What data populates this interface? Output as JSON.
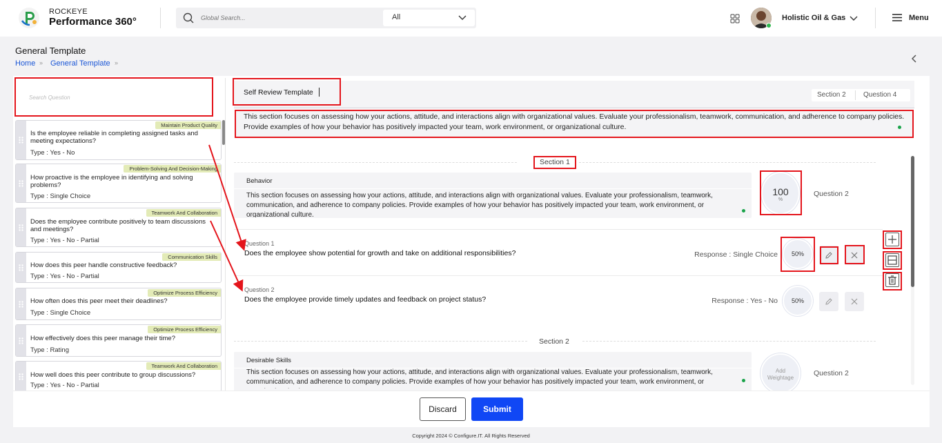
{
  "header": {
    "brand_small": "ROCKEYE",
    "brand_big": "Performance 360°",
    "search_placeholder": "Global Search...",
    "search_scope": "All",
    "org_name": "Holistic Oil & Gas",
    "menu_label": "Menu"
  },
  "page": {
    "title": "General Template",
    "breadcrumb": [
      "Home",
      "General Template"
    ]
  },
  "left_panel": {
    "search_placeholder": "Search Question",
    "questions": [
      {
        "tag": "Maintain Product Quality",
        "text": "Is the employee reliable in completing assigned tasks and meeting expectations?",
        "type": "Type : Yes - No"
      },
      {
        "tag": "Problem-Solving And Decision-Making",
        "text": "How proactive is the employee in identifying and solving problems?",
        "type": "Type : Single Choice"
      },
      {
        "tag": "Teamwork And Collaboration",
        "text": "Does the employee contribute positively to team discussions and meetings?",
        "type": "Type : Yes - No - Partial"
      },
      {
        "tag": "Communication Skills",
        "text": "How does this peer handle constructive feedback?",
        "type": "Type : Yes - No - Partial"
      },
      {
        "tag": "Optimize Process Efficiency",
        "text": "How often does this peer meet their deadlines?",
        "type": "Type : Single Choice"
      },
      {
        "tag": "Optimize Process Efficiency",
        "text": "How effectively does this peer manage their time?",
        "type": "Type : Rating"
      },
      {
        "tag": "Teamwork And Collaboration",
        "text": "How well does this peer contribute to group discussions?",
        "type": "Type : Yes - No - Partial"
      }
    ]
  },
  "template": {
    "title": "Self Review Template",
    "section_count": "Section 2",
    "question_count": "Question 4",
    "description": "This section focuses on assessing how your actions, attitude, and interactions align with organizational values. Evaluate your professionalism, teamwork, communication, and adherence to company policies. Provide examples of how your behavior has positively impacted your team, work environment, or organizational culture."
  },
  "sections": [
    {
      "label": "Section 1",
      "name": "Behavior",
      "description": "This section focuses on assessing how your actions, attitude, and interactions align with organizational values. Evaluate your professionalism, teamwork, communication, and adherence to company policies. Provide examples of how your behavior has positively impacted your team, work environment, or organizational culture.",
      "weight_value": "100",
      "weight_unit": "%",
      "question_count": "Question 2",
      "questions": [
        {
          "label": "Question 1",
          "text": "Does the employee show potential for growth and take on additional responsibilities?",
          "response": "Response : Single Choice",
          "weight": "50%"
        },
        {
          "label": "Question 2",
          "text": "Does the employee provide timely updates and feedback on project status?",
          "response": "Response : Yes - No",
          "weight": "50%"
        }
      ]
    },
    {
      "label": "Section 2",
      "name": "Desirable Skills",
      "description": "This section focuses on assessing how your actions, attitude, and interactions align with organizational values. Evaluate your professionalism, teamwork, communication, and adherence to company policies. Provide examples of how your behavior has positively impacted your team, work environment, or organizational culture.",
      "weight_label": "Add Weightage",
      "question_count": "Question 2"
    }
  ],
  "footer": {
    "discard": "Discard",
    "submit": "Submit",
    "copyright": "Copyright 2024 © Configure.IT. All Rights Reserved"
  },
  "colors": {
    "primary": "#1047f5",
    "highlight": "#e4141b",
    "tag_bg": "#e3ebb7",
    "status_green": "#1aa34a"
  }
}
